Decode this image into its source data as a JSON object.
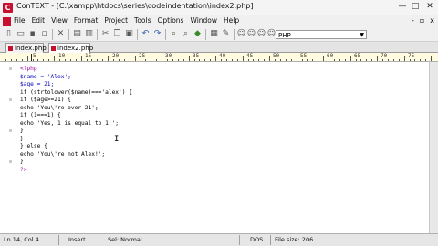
{
  "titlebar": {
    "app_icon": "C",
    "title": "ConTEXT - [C:\\xampp\\htdocs\\series\\codeindentation\\index2.php]"
  },
  "window_buttons": {
    "minimize": "—",
    "maximize": "□",
    "close": "✕"
  },
  "menu": [
    "File",
    "Edit",
    "View",
    "Format",
    "Project",
    "Tools",
    "Options",
    "Window",
    "Help"
  ],
  "menu_right": {
    "minimize": "-",
    "restore": "▫",
    "close": "x"
  },
  "toolbar": {
    "syntax_value": "PHP"
  },
  "tabs": [
    {
      "label": "index.php",
      "active": false
    },
    {
      "label": "index2.php",
      "active": true
    }
  ],
  "ruler": {
    "labels": [
      "5",
      "10",
      "15",
      "20",
      "25",
      "30",
      "35",
      "40",
      "45",
      "50",
      "55",
      "60",
      "65",
      "70",
      "75"
    ]
  },
  "code_lines": [
    "<?php",
    "$name = 'Alex';",
    "$age = 21;",
    "if (strtolower($name)==='alex') {",
    "if ($age>=21) {",
    "echo 'You\\'re over 21';",
    "if (1===1) {",
    "echo 'Yes, 1 is equal to 1!';",
    "}",
    "}",
    "} else {",
    "echo 'You\\'re not Alex!';",
    "}",
    "?>"
  ],
  "status": {
    "position": "Ln 14, Col 4",
    "mode": "Insert",
    "selection": "Sel: Normal",
    "format": "DOS",
    "filesize": "File size: 206"
  }
}
